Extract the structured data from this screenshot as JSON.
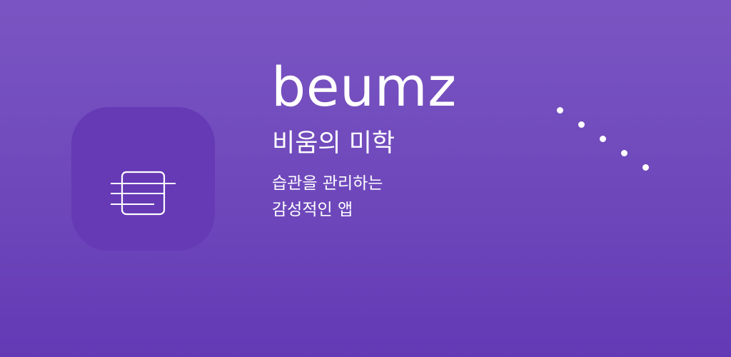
{
  "app": {
    "icon": "staff-notes-icon",
    "name": "beumz",
    "tagline": "비움의 미학",
    "description_lines": [
      "습관을 관리하는",
      "감성적인 앱"
    ]
  },
  "decoration": {
    "dots_count": 5
  },
  "colors": {
    "background_top": "#7a55c2",
    "background_bottom": "#6439b5",
    "icon_tile": "#6639b5",
    "text": "#ffffff"
  }
}
